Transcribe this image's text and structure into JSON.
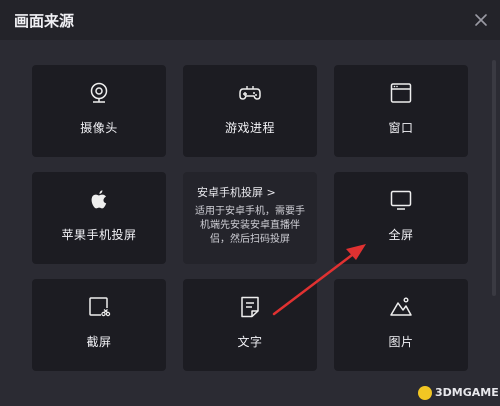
{
  "window": {
    "title": "画面来源"
  },
  "tiles": [
    {
      "label": "摄像头",
      "icon": "webcam-icon"
    },
    {
      "label": "游戏进程",
      "icon": "gamepad-icon"
    },
    {
      "label": "窗口",
      "icon": "window-icon"
    },
    {
      "label": "苹果手机投屏",
      "icon": "apple-icon"
    },
    {
      "label": "全屏",
      "icon": "monitor-icon"
    },
    {
      "label": "截屏",
      "icon": "screenshot-icon"
    },
    {
      "label": "文字",
      "icon": "text-doc-icon"
    },
    {
      "label": "图片",
      "icon": "image-icon"
    }
  ],
  "info_tile": {
    "heading": "安卓手机投屏 >",
    "text": "适用于安卓手机，需要手机端先安装安卓直播伴侣，然后扫码投屏"
  },
  "watermark": {
    "text": "3DMGAME"
  },
  "colors": {
    "accent_arrow": "#e03131",
    "background": "#2b2b33",
    "tile": "#1c1c22"
  }
}
